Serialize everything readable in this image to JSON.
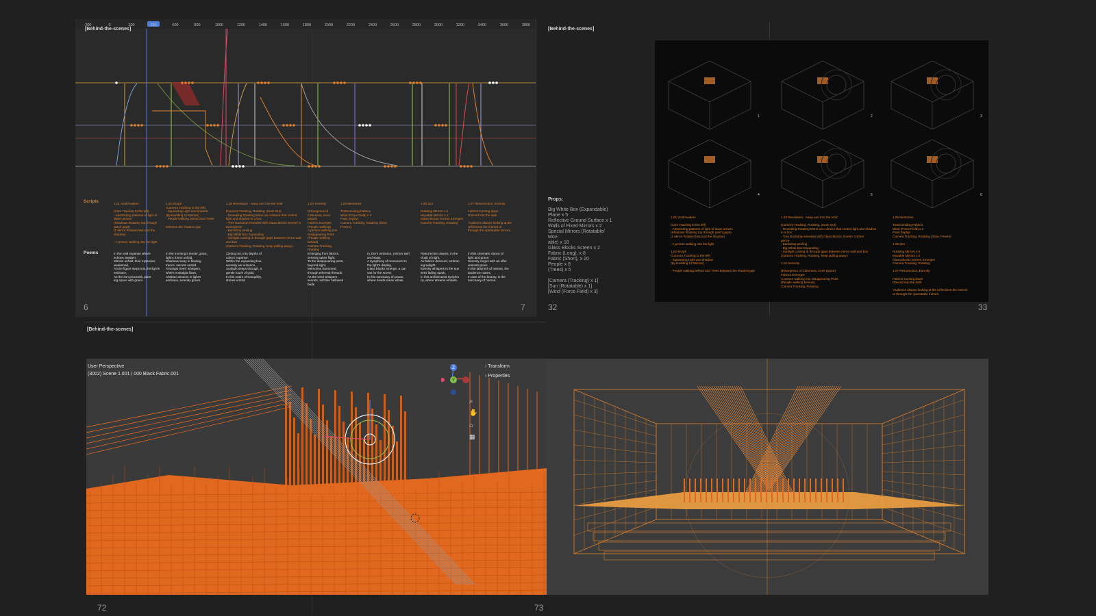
{
  "spread1": {
    "tag": "[Behind-the-scenes]",
    "ruler": [
      "-200",
      "0",
      "200",
      "330",
      "600",
      "800",
      "1000",
      "1200",
      "1400",
      "1600",
      "1800",
      "2000",
      "2200",
      "2400",
      "2600",
      "2800",
      "3000",
      "3200",
      "3400",
      "3600",
      "3800"
    ],
    "playhead": "330",
    "scripts_label": "Scripts",
    "poems_label": "Poems",
    "scripts": [
      "1.01 Void/Awaken\n\n(Cam Tracking to the left)\n- Abstracting patterns of light of dawn arrives\n(Shadows Rotating top through patch gaps)\n(1 Mirror Rotated Mat and the shadow)\n\n- A person walking into the light",
      "1.02 Morph\n(Camera Tracking to the left)\n- Squeezing Light and shadow\n(By Nodding 13 Mirrors)\n- People walking behind and Trees\n\nbetween the shadow gap",
      "1.03 Revelation - Away and into the Void\n\n(Camera Tracking, Rotating, Zoom Out)\n- Revealing Rotating Mirror as a device that control light and shadow in a box\n- Tree Backdrop revealed with Glass Blocks Screen' s Emergence\n- Backdrop peeling\n- Big White Box Expanding\n- Sunlight coming in through gaps between mirror wall and box\n(Camera Tracking, Rotating, keep pulling away.)",
      "1.04 Serenity\n\n(Emergence of Calmness, inner peace)\nFabrics Emerges\n(People walking)\nA person walking into Disappearing Point\n(People walking behind)\nCamera Tracking, Rotating",
      "1.05 Memories\n\nTranscending Fabrics\nWind (Force Field) x 3\nPaint Zephyr\nCamera Tracking, Rotating (Slow, Freeze)",
      "1.06 Zen\n\nRotating Mirrors x 6\nMovable Mirrors x 2\nGlass Blocks Screen Emerges\nCamera Tracking, Rotating",
      "1.07 Resurrection, Eternity\n\nFabrics Coming down\nDanced into the dark\n\n'Audience always looking at the reflections the mirrors or through the operatable mirrors."
    ],
    "poems": [
      "In the void expanse where echoes awaken,\nMirrors unfold, their mysteries awakened,\nA lone figure steps into the light's embrace,\nAs the sun proceeds, paint\ning space with grace.",
      "In the morning's tender grace,\nlight's forms unfold,\nShadows sway in fleeting\ntrance, secrets untold,\nAmongst trees' whispers,\nwhere nostalgia flows,\nAbstract dreams in light's\nembrace, serenity grows.",
      "Zoning out, into depths of\ncalm's expanse,\nWithin the expanding box,\nserenity we enhance,\nSunlight seeps through, a\ngentle touch of gold,\nIn this realm of tranquility,\nstories unfold.",
      "Emerging from fabrics,\nserenity takes flight,\nTo the disappearing point,\nbeyond sight,\nMemories transcend\nthrough ethereal threads,\nAs the wind whispers\nsecrets, soft like hallowed\nbeds.",
      "In Zen's embrace, mirrors twirl\nand sway,\nA symphony of movement in\nthe light's display,\nGlass blocks emerge, a can\nvas for the scene,\nIn this sanctuary of peace,\nwhere hearts mean whole.",
      "Resurrection dawns, in the\ncloak of night,\nAs fabrics descend, embrac\ning twilight,\nEternity whispers in the sun\nset's fading spark,\nIn this architectural sympho\nny, where dreams embark.",
      "In this cinematic dance of\nlight and grace,\nSerenity reigns with an effer\nvescent grace,\nIn the labyrinth of mirrors, the\naudience roams,\nIn awe of the beauty, in the\nsanctuary of homes."
    ],
    "page_left": "6",
    "page_right": "7"
  },
  "spread2": {
    "tag": "[Behind-the-scenes]",
    "props_title": "Props:",
    "props": "Big White Box (Expandable)\nPlane x 5\nReflective Ground Surface x 1\nWalls of Fixed Mirrors x 2\nSpecial Mirrors (Rotatable/ Mov-\nable) x 18\nGlass Blocks Screen x 2\nFabric (Long), x 8\nFabric (Short), x 20\nPeople x 8\n(Trees) x 5\n\n[Camera (Tracking) x 1]\n[Sun (Rotatable) x 1]\n[Wind (Force Field) x 3]",
    "frames": [
      "1",
      "2",
      "3",
      "4",
      "5",
      "6"
    ],
    "notes": [
      "1.01 Void/Awaken\n\n(Cam Tracking to the left)\n- Abstracting patterns of light of dawn arrives\n(Shadows Rotating top through patch gaps)\n(1 Mirror Rotated Mat and the shadow)\n\n- A person walking into the light\n\n1.02 Morph\n(Camera Tracking to the left)\n- Squeezing Light and shadow\n(By Nodding 13 Mirrors)\n\n- People walking behind and Trees between the shadow gap",
      "1.03 Revelation - Away and into the Void\n\n(Camera Tracking, Rotating, Zoom Out)\n- Revealing Rotating Mirror as a device that control light and shadow in a box\n- Tree Backdrop revealed with Glass Blocks Screen' s Emer\ngence\n- Backdrop peeling\n- Big White Box Expanding\n- Sunlight coming in through gaps between mirror wall and box\n(Camera Tracking, Rotating, keep pulling away.)\n\n1.04 Serenity\n\n(Emergence of Calmness, inner peace)\nFabrics Emerges\nA person walking into Disappearing Point\n(People walking behind)\nCamera Tracking, Rotating",
      "1.05 Memories\n\nTranscending Fabrics\nWind (Force Field) x 3\nPaint Zephyr\nCamera Tracking, Rotating (Slow, Freeze)\n\n1.06 Zen\n\nRotating Mirrors x 6\nMovable Mirrors x 2\nGlass Blocks Screen Emerges\nCamera Tracking, Rotating\n\n1.07 Resurrection, Eternity\n\nFabrics Coming down\nDanced into the dark\n\n'Audience always looking at the reflections the mirrors or through the operatable mirrors."
    ],
    "page_left": "32",
    "page_right": "33"
  },
  "spread3": {
    "tag": "[Behind-the-scenes]",
    "viewport_line1": "User Perspective",
    "viewport_line2": "(3002) Scene 1.001 | 000 Black Fabric.001",
    "panel_transform": "Transform",
    "panel_properties": "Properties",
    "gizmo_axes": [
      "Z",
      "Y",
      "X"
    ],
    "page_left": "72",
    "page_right": "73"
  },
  "colors": {
    "background": "#202020",
    "orange": "#e0822f",
    "wire_orange": "#e0681f",
    "editor_bg": "#2a2a2a"
  }
}
